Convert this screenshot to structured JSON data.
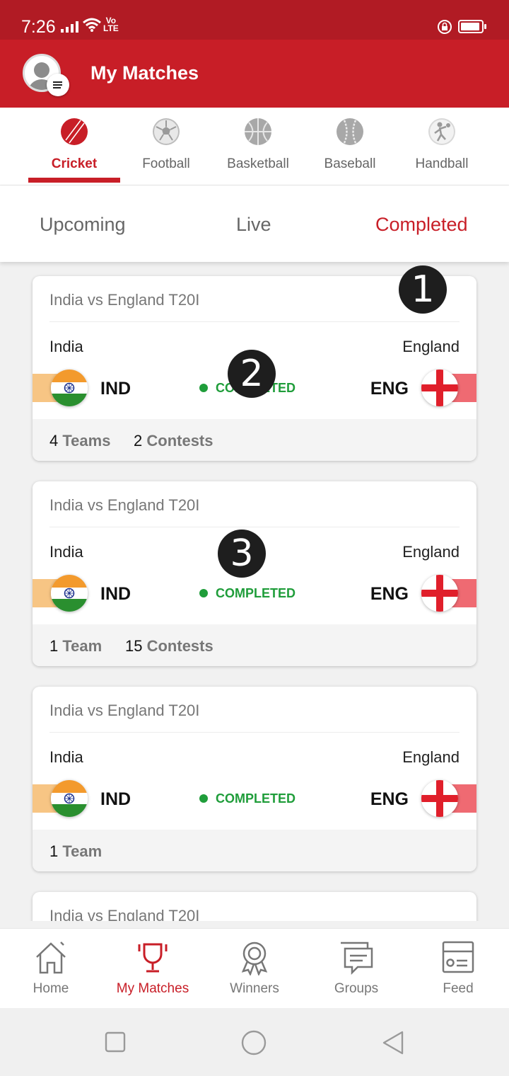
{
  "status_bar": {
    "time": "7:26",
    "volte_top": "Vo",
    "volte_bottom": "LTE"
  },
  "app_bar": {
    "title": "My Matches"
  },
  "sport_tabs": [
    {
      "label": "Cricket",
      "icon": "cricket-ball-icon",
      "active": true
    },
    {
      "label": "Football",
      "icon": "football-icon",
      "active": false
    },
    {
      "label": "Basketball",
      "icon": "basketball-icon",
      "active": false
    },
    {
      "label": "Baseball",
      "icon": "baseball-icon",
      "active": false
    },
    {
      "label": "Handball",
      "icon": "handball-icon",
      "active": false
    }
  ],
  "match_tabs": [
    {
      "label": "Upcoming",
      "active": false
    },
    {
      "label": "Live",
      "active": false
    },
    {
      "label": "Completed",
      "active": true
    }
  ],
  "matches": [
    {
      "name": "India vs England T20I",
      "team1": "India",
      "team1_code": "IND",
      "team2": "England",
      "team2_code": "ENG",
      "status": "COMPLETED",
      "teams_count": "4",
      "teams_label": "Teams",
      "contests_count": "2",
      "contests_label": "Contests"
    },
    {
      "name": "India vs England T20I",
      "team1": "India",
      "team1_code": "IND",
      "team2": "England",
      "team2_code": "ENG",
      "status": "COMPLETED",
      "teams_count": "1",
      "teams_label": "Team",
      "contests_count": "15",
      "contests_label": "Contests"
    },
    {
      "name": "India vs England T20I",
      "team1": "India",
      "team1_code": "IND",
      "team2": "England",
      "team2_code": "ENG",
      "status": "COMPLETED",
      "teams_count": "1",
      "teams_label": "Team",
      "contests_count": "",
      "contests_label": ""
    },
    {
      "name": "India vs England T20I"
    }
  ],
  "annotation_markers": [
    "1",
    "2",
    "3"
  ],
  "bottom_nav": [
    {
      "label": "Home",
      "icon": "home-icon",
      "active": false
    },
    {
      "label": "My Matches",
      "icon": "trophy-icon",
      "active": true
    },
    {
      "label": "Winners",
      "icon": "award-icon",
      "active": false
    },
    {
      "label": "Groups",
      "icon": "chat-icon",
      "active": false
    },
    {
      "label": "Feed",
      "icon": "feed-icon",
      "active": false
    }
  ],
  "colors": {
    "brand_red": "#c81e27",
    "status_bar_red": "#b11b24",
    "completed_green": "#1f9d3a"
  }
}
